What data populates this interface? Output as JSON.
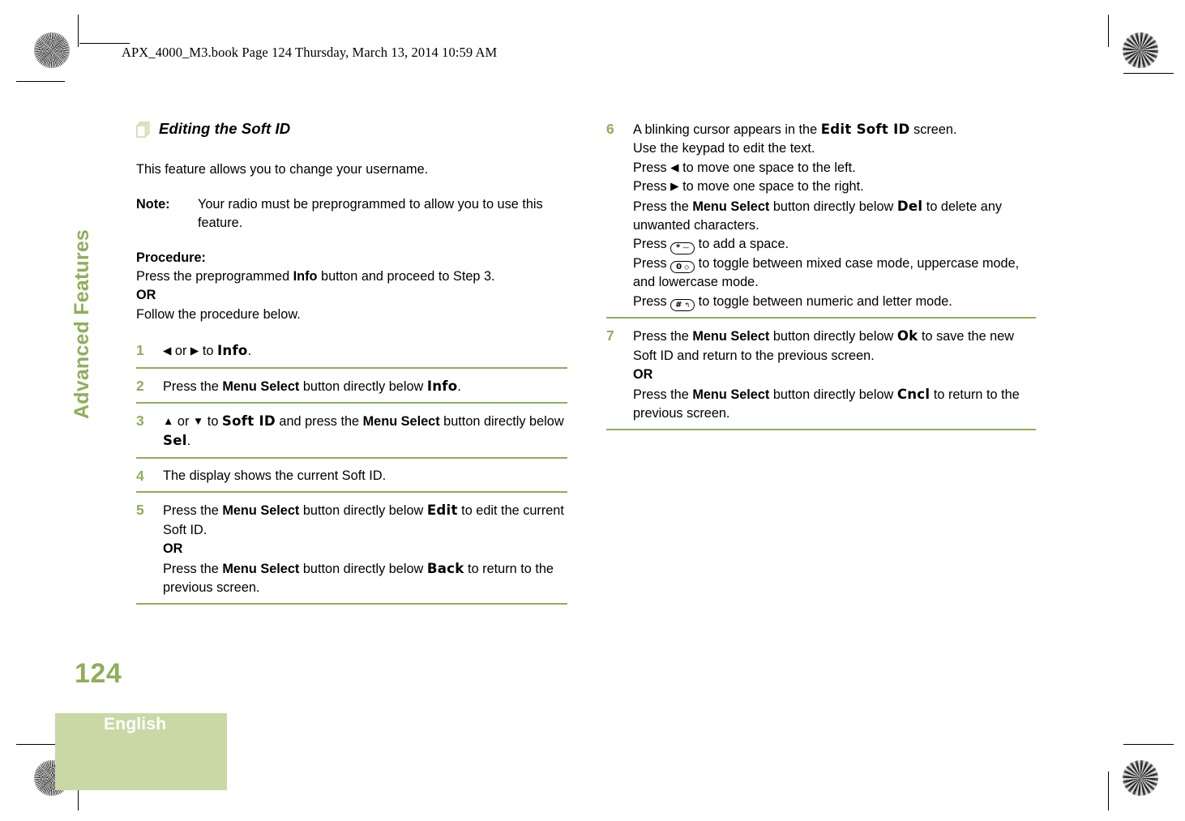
{
  "header": {
    "text": "APX_4000_M3.book  Page 124  Thursday, March 13, 2014  10:59 AM"
  },
  "sidebar": {
    "chapter_title": "Advanced Features",
    "page_number": "124",
    "language_tab": "English"
  },
  "colors": {
    "accent_green": "#8fae5b",
    "tab_green": "#c9d8a5",
    "icon_green": "#c9d8a5"
  },
  "left_column": {
    "heading": "Editing the Soft ID",
    "heading_icon": "stacked-pages-icon",
    "intro": "This feature allows you to change your username.",
    "note_label": "Note:",
    "note_text": "Your radio must be preprogrammed to allow you to use this feature.",
    "procedure_label": "Procedure:",
    "procedure_line_1_a": "Press the preprogrammed ",
    "procedure_line_1_b": "Info",
    "procedure_line_1_c": " button and proceed to Step 3.",
    "or": "OR",
    "procedure_line_2": "Follow the procedure below.",
    "steps": [
      {
        "num": "1",
        "parts": [
          {
            "t": "arrow",
            "v": "◀"
          },
          {
            "t": "plain",
            "v": " or "
          },
          {
            "t": "arrow",
            "v": "▶"
          },
          {
            "t": "plain",
            "v": " to "
          },
          {
            "t": "disp",
            "v": "Info"
          },
          {
            "t": "plain",
            "v": "."
          }
        ]
      },
      {
        "num": "2",
        "parts": [
          {
            "t": "plain",
            "v": "Press the "
          },
          {
            "t": "bold",
            "v": "Menu Select"
          },
          {
            "t": "plain",
            "v": " button directly below "
          },
          {
            "t": "disp",
            "v": "Info"
          },
          {
            "t": "plain",
            "v": "."
          }
        ]
      },
      {
        "num": "3",
        "parts": [
          {
            "t": "arrow",
            "v": "▲"
          },
          {
            "t": "plain",
            "v": " or "
          },
          {
            "t": "arrow",
            "v": "▼"
          },
          {
            "t": "plain",
            "v": " to "
          },
          {
            "t": "disp",
            "v": "Soft ID"
          },
          {
            "t": "plain",
            "v": " and press the "
          },
          {
            "t": "bold",
            "v": "Menu Select"
          },
          {
            "t": "plain",
            "v": " button directly below "
          },
          {
            "t": "disp",
            "v": "Sel"
          },
          {
            "t": "plain",
            "v": "."
          }
        ]
      },
      {
        "num": "4",
        "parts": [
          {
            "t": "plain",
            "v": "The display shows the current Soft ID."
          }
        ]
      },
      {
        "num": "5",
        "parts": [
          {
            "t": "plain",
            "v": "Press the "
          },
          {
            "t": "bold",
            "v": "Menu Select"
          },
          {
            "t": "plain",
            "v": " button directly below "
          },
          {
            "t": "disp",
            "v": "Edit"
          },
          {
            "t": "plain",
            "v": " to edit the current Soft ID."
          },
          {
            "t": "br"
          },
          {
            "t": "bold",
            "v": "OR"
          },
          {
            "t": "br"
          },
          {
            "t": "plain",
            "v": "Press the "
          },
          {
            "t": "bold",
            "v": "Menu Select"
          },
          {
            "t": "plain",
            "v": " button directly below "
          },
          {
            "t": "disp",
            "v": "Back"
          },
          {
            "t": "plain",
            "v": " to return to the previous screen."
          }
        ]
      }
    ]
  },
  "right_column": {
    "steps": [
      {
        "num": "6",
        "parts": [
          {
            "t": "plain",
            "v": "A blinking cursor appears in the "
          },
          {
            "t": "disp",
            "v": "Edit Soft ID"
          },
          {
            "t": "plain",
            "v": " screen."
          },
          {
            "t": "br"
          },
          {
            "t": "plain",
            "v": "Use the keypad to edit the text."
          },
          {
            "t": "br"
          },
          {
            "t": "plain",
            "v": "Press "
          },
          {
            "t": "arrow",
            "v": "◀"
          },
          {
            "t": "plain",
            "v": " to move one space to the left."
          },
          {
            "t": "br"
          },
          {
            "t": "plain",
            "v": "Press "
          },
          {
            "t": "arrow",
            "v": "▶"
          },
          {
            "t": "plain",
            "v": " to move one space to the right."
          },
          {
            "t": "br"
          },
          {
            "t": "plain",
            "v": "Press the "
          },
          {
            "t": "bold",
            "v": "Menu Select"
          },
          {
            "t": "plain",
            "v": " button directly below "
          },
          {
            "t": "disp",
            "v": "Del"
          },
          {
            "t": "plain",
            "v": " to delete any unwanted characters."
          },
          {
            "t": "br"
          },
          {
            "t": "plain",
            "v": "Press "
          },
          {
            "t": "key",
            "k1": "*",
            "k2": "—",
            "name": "star-key-icon"
          },
          {
            "t": "plain",
            "v": " to add a space."
          },
          {
            "t": "br"
          },
          {
            "t": "plain",
            "v": "Press "
          },
          {
            "t": "key",
            "k1": "0",
            "k2": "◇",
            "name": "zero-key-icon"
          },
          {
            "t": "plain",
            "v": " to toggle between mixed case mode, uppercase mode, and lowercase mode."
          },
          {
            "t": "br"
          },
          {
            "t": "plain",
            "v": "Press "
          },
          {
            "t": "key",
            "k1": "#",
            "k2": "↰",
            "name": "pound-key-icon"
          },
          {
            "t": "plain",
            "v": " to toggle between numeric and letter mode."
          }
        ]
      },
      {
        "num": "7",
        "parts": [
          {
            "t": "plain",
            "v": "Press the "
          },
          {
            "t": "bold",
            "v": "Menu Select"
          },
          {
            "t": "plain",
            "v": " button directly below "
          },
          {
            "t": "disp",
            "v": "Ok"
          },
          {
            "t": "plain",
            "v": " to save the new Soft ID and return to the previous screen."
          },
          {
            "t": "br"
          },
          {
            "t": "bold",
            "v": "OR"
          },
          {
            "t": "br"
          },
          {
            "t": "plain",
            "v": "Press the "
          },
          {
            "t": "bold",
            "v": "Menu Select"
          },
          {
            "t": "plain",
            "v": " button directly below "
          },
          {
            "t": "disp",
            "v": "Cncl"
          },
          {
            "t": "plain",
            "v": " to return to the previous screen."
          }
        ]
      }
    ]
  }
}
